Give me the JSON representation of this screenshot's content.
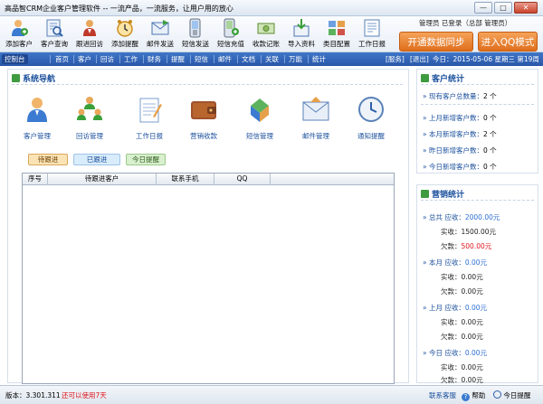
{
  "window": {
    "title": "高品智CRM企业客户管理软件 -- 一流产品，一流服务，让用户用的放心",
    "min_label": "—",
    "max_label": "□",
    "close_label": "✕"
  },
  "toolbar": {
    "items": [
      {
        "label": "添加客户",
        "icon": "add-customer-icon"
      },
      {
        "label": "客户查询",
        "icon": "customer-search-icon"
      },
      {
        "label": "跟进回访",
        "icon": "follow-up-icon"
      },
      {
        "label": "添加提醒",
        "icon": "alarm-clock-icon"
      },
      {
        "label": "邮件发送",
        "icon": "mail-send-icon"
      },
      {
        "label": "短信发送",
        "icon": "sms-send-icon"
      },
      {
        "label": "短信充值",
        "icon": "sms-recharge-icon"
      },
      {
        "label": "收款记账",
        "icon": "money-icon"
      },
      {
        "label": "导入资料",
        "icon": "import-icon"
      },
      {
        "label": "类目配置",
        "icon": "category-config-icon"
      },
      {
        "label": "工作日报",
        "icon": "daily-report-icon"
      }
    ],
    "user_info": "管理员  已登录（总部 管理员）",
    "open_sync": "开通数据同步",
    "qq_mode": "进入QQ模式"
  },
  "navbar": {
    "items": [
      "控制台",
      "首页",
      "客户",
      "回访",
      "工作",
      "财务",
      "提醒",
      "短信",
      "邮件",
      "文档",
      "关联",
      "万能",
      "统计"
    ],
    "service": "[服务]",
    "exit": "[退出]",
    "date_info": "今日：2015-05-06 星期三 第19周"
  },
  "system_nav": {
    "title": "系统导航",
    "items": [
      {
        "label": "客户管理",
        "icon": "customer-management-icon"
      },
      {
        "label": "回访管理",
        "icon": "visit-management-icon"
      },
      {
        "label": "工作日报",
        "icon": "work-report-icon"
      },
      {
        "label": "营销收款",
        "icon": "wallet-icon"
      },
      {
        "label": "短信管理",
        "icon": "sms-management-icon"
      },
      {
        "label": "邮件管理",
        "icon": "mail-management-icon"
      },
      {
        "label": "通知提醒",
        "icon": "notify-clock-icon"
      }
    ]
  },
  "tabs": {
    "pending": "待跟进",
    "done": "已跟进",
    "today": "今日提醒"
  },
  "grid": {
    "columns": [
      "序号",
      "待跟进客户",
      "联系手机",
      "QQ"
    ]
  },
  "customer_stats": {
    "title": "客户统计",
    "rows": [
      {
        "label": "» 现有客户总数量：",
        "value": "2 个"
      },
      {
        "label": "» 上月新增客户数：",
        "value": "0 个"
      },
      {
        "label": "» 本月新增客户数：",
        "value": "2 个"
      },
      {
        "label": "» 昨日新增客户数：",
        "value": "0 个"
      },
      {
        "label": "» 今日新增客户数：",
        "value": "0 个"
      }
    ]
  },
  "sales_stats": {
    "title": "营销统计",
    "groups": [
      {
        "label": "» 总共 应收：",
        "due": "2000.00元",
        "received_label": "实收：",
        "received": "1500.00元",
        "owed_label": "欠款：",
        "owed": "500.00元"
      },
      {
        "label": "» 本月 应收：",
        "due": "0.00元",
        "received_label": "实收：",
        "received": "0.00元",
        "owed_label": "欠款：",
        "owed": "0.00元"
      },
      {
        "label": "» 上月 应收：",
        "due": "0.00元",
        "received_label": "实收：",
        "received": "0.00元",
        "owed_label": "欠款：",
        "owed": "0.00元"
      },
      {
        "label": "» 今日 应收：",
        "due": "0.00元",
        "received_label": "实收：",
        "received": "0.00元",
        "owed_label": "欠款：",
        "owed": "0.00元"
      }
    ]
  },
  "status": {
    "version": "版本：3.301.311",
    "trial": "还可以使用7天",
    "contact": "联系客服",
    "help": "帮助",
    "today_reminder": "今日提醒"
  },
  "colors": {
    "accent": "#2957a8",
    "orange_button": "#df6e1c",
    "red_text": "#e0151c",
    "green_box": "#3f9b3f"
  }
}
